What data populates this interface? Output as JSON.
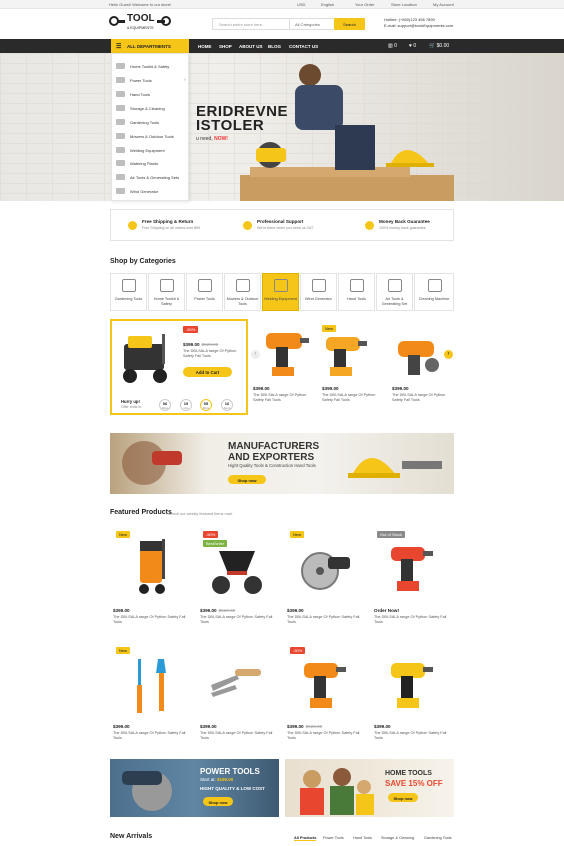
{
  "topbar": {
    "welcome": "Hello Guest! Welcome to our store!",
    "currency": "USD",
    "language": "English",
    "order": "Your Order",
    "store": "Store Location",
    "account": "My Account"
  },
  "header": {
    "logo_main": "TOOL",
    "logo_sub": "& EQUIPMENTS",
    "search_placeholder": "Search entire store here...",
    "search_category": "All Categories",
    "search_button": "Search",
    "hotline": "Hotline: (+800)123 456 7890",
    "email": "E-mail: support@toolsEquipments.com"
  },
  "nav": {
    "all_departments": "ALL DEPARTMENTS",
    "links": [
      "HOME",
      "SHOP",
      "ABOUT US",
      "BLOG",
      "CONTACT US"
    ],
    "compare_count": "0",
    "wish_count": "0",
    "cart_total": "$0.00"
  },
  "menu": [
    "Home Toolkit & Safety",
    "Power Tools",
    "Hand Tools",
    "Storage & Cleaning",
    "Gardening Tools",
    "Mowers & Outdoor Tools",
    "Welding Equipment",
    "Watering Plants",
    "Air Tools & Generating Sets",
    "Wind Generator"
  ],
  "hero": {
    "line1": "ERIDREVNE",
    "line2": "ISTOLER",
    "sub_prefix": "u need,",
    "sub_highlight": "NOW!"
  },
  "services": [
    {
      "title": "Free Shipping & Return",
      "sub": "Free Shipping on all orders over $99"
    },
    {
      "title": "Professional Support",
      "sub": "We're there when you need us 24/7"
    },
    {
      "title": "Money Back Guarantee",
      "sub": "100% money back guarantee"
    }
  ],
  "categories_title": "Shop by Categories",
  "categories": [
    "Gardening Tools",
    "Home Toolkit & Safety",
    "Power Tools",
    "Mowers & Outdoor Tools",
    "Welding Equipment",
    "Wind Generator",
    "Hand Tools",
    "Air Tools & Generating Set",
    "Cleaning Machine"
  ],
  "deal": {
    "badge": "-50%",
    "price": "$399.00",
    "old": "$520.00",
    "desc": "The DBI-SALA range Of Python Safety Fall Tools",
    "button": "Add to Cart",
    "hurry": "Hurry up!",
    "offer": "Offer ends in:",
    "timer": [
      {
        "v": "06",
        "l": "Days"
      },
      {
        "v": "19",
        "l": "Hrs"
      },
      {
        "v": "05",
        "l": "Mins"
      },
      {
        "v": "16",
        "l": "Secs"
      }
    ]
  },
  "deal_products": [
    {
      "price": "$399.00",
      "desc": "The DBI-SALA range Of Python Safety Fall Tools",
      "badge": ""
    },
    {
      "price": "$399.00",
      "desc": "The DBI-SALA range Of Python Safety Fall Tools",
      "badge": "New"
    },
    {
      "price": "$399.00",
      "desc": "The DBI-SALA range Of Python Safety Fall Tools",
      "badge": ""
    }
  ],
  "banner1": {
    "title1": "MANUFACTURERS",
    "title2": "AND EXPORTERS",
    "sub": "Hight Quality Tools & Construction Hand Tools",
    "button": "Shop now"
  },
  "featured": {
    "title": "Featured Products",
    "sub": "- Check our weekly featured items now!"
  },
  "products": [
    {
      "badge": "New",
      "badge2": "",
      "price": "$399.00",
      "old": "",
      "desc": "The DBI-SALA range Of Python Safety Fall Tools"
    },
    {
      "badge": "-50%",
      "badge2": "BestSeller",
      "price": "$399.00",
      "old": "$520.00",
      "desc": "The DBI-SALA range Of Python Safety Fall Tools"
    },
    {
      "badge": "New",
      "badge2": "",
      "price": "$399.00",
      "old": "",
      "desc": "The DBI-SALA range Of Python Safety Fall Tools"
    },
    {
      "badge": "Out of Stock",
      "badge2": "",
      "price": "Order Now!",
      "old": "",
      "desc": "The DBI-SALA range Of Python Safety Fall Tools"
    },
    {
      "badge": "New",
      "badge2": "",
      "price": "$399.00",
      "old": "",
      "desc": "The DBI-SALA range Of Python Safety Fall Tools"
    },
    {
      "badge": "",
      "badge2": "",
      "price": "$399.00",
      "old": "",
      "desc": "The DBI-SALA range Of Python Safety Fall Tools"
    },
    {
      "badge": "-50%",
      "badge2": "",
      "price": "$399.00",
      "old": "$520.00",
      "desc": "The DBI-SALA range Of Python Safety Fall Tools"
    },
    {
      "badge": "",
      "badge2": "",
      "price": "$399.00",
      "old": "",
      "desc": "The DBI-SALA range Of Python Safety Fall Tools"
    }
  ],
  "banner2": {
    "title": "POWER TOOLS",
    "start": "Start at:",
    "price": "$199.00",
    "tag": "HIGHT QUALITY & LOW COST",
    "button": "Shop now"
  },
  "banner3": {
    "title": "HOME TOOLS",
    "save": "SAVE 15% OFF",
    "button": "Shop now"
  },
  "new_arrivals": {
    "title": "New Arrivals",
    "tabs": [
      "All Products",
      "Power Tools",
      "Hand Tools",
      "Storage & Cleaning",
      "Gardening Tools"
    ]
  },
  "colors": {
    "accent": "#f5c518",
    "dark": "#2a2a2a",
    "sale": "#e8462e"
  }
}
